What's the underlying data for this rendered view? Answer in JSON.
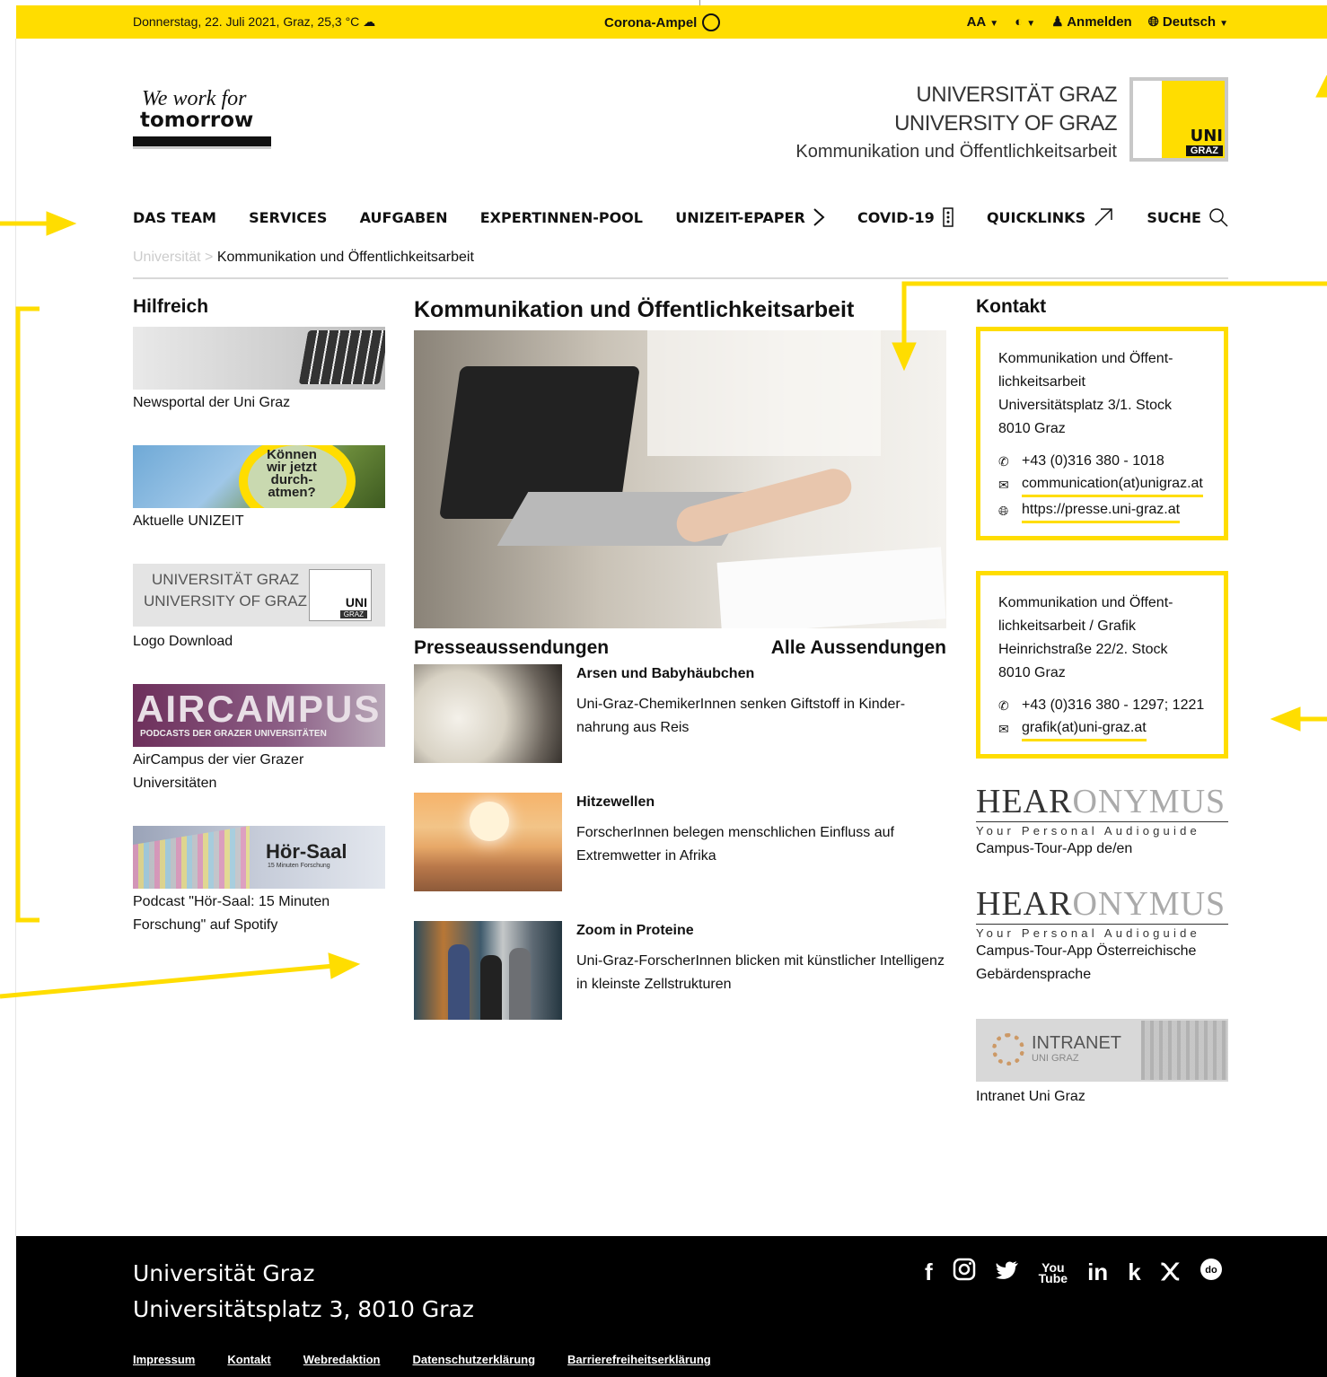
{
  "topbar": {
    "date_weather": "Donnerstag, 22. Juli 2021, Graz, 25,3 °C",
    "weather_icon": "cloud-icon",
    "corona": "Corona-Ampel",
    "font_size": "AA",
    "login": "Anmelden",
    "language": "Deutsch"
  },
  "header": {
    "tagline_1": "We work for",
    "tagline_2": "tomorrow",
    "name_de": "UNIVERSITÄT GRAZ",
    "name_en": "UNIVERSITY OF GRAZ",
    "department": "Kommunikation und Öffentlichkeitsarbeit",
    "logo_uni": "UNI",
    "logo_graz": "GRAZ"
  },
  "nav": {
    "items": [
      "DAS TEAM",
      "SERVICES",
      "AUFGABEN",
      "EXPERTINNEN-POOL",
      "UNIZEIT-EPAPER",
      "COVID-19",
      "QUICKLINKS",
      "SUCHE"
    ]
  },
  "breadcrumb": {
    "root": "Universität",
    "sep": ">",
    "current": "Kommunikation und Öffentlichkeitsarbeit"
  },
  "left": {
    "title": "Hilfreich",
    "tiles": [
      {
        "caption": "Newsportal der Uni Graz"
      },
      {
        "caption": "Aktuelle UNIZEIT",
        "image_text": "Können wir jetzt durch-atmen?"
      },
      {
        "caption": "Logo Download",
        "image_text_1": "UNIVERSITÄT GRAZ",
        "image_text_2": "UNIVERSITY OF GRAZ",
        "logo_uni": "UNI",
        "logo_graz": "GRAZ"
      },
      {
        "caption": "AirCampus der vier Grazer Universitäten",
        "image_text": "AIRCAMPUS",
        "image_sub": "PODCASTS DER GRAZER UNIVERSITÄTEN"
      },
      {
        "caption": "Podcast \"Hör-Saal: 15 Minuten Forschung\" auf Spotify",
        "image_text": "Hör-Saal",
        "image_sub": "15 Minuten Forschung"
      }
    ]
  },
  "main": {
    "title": "Kommunikation und Öffentlichkeitsarbeit",
    "press_title": "Presseaussendungen",
    "all_link": "Alle Aussendungen",
    "news": [
      {
        "title": "Arsen und Babyhäubchen",
        "desc": "Uni-Graz-ChemikerInnen senken Giftstoff in Kinder­nahrung aus Reis"
      },
      {
        "title": "Hitzewellen",
        "desc": "ForscherInnen belegen menschlichen Einfluss auf Extremwetter in Afrika"
      },
      {
        "title": "Zoom in Proteine",
        "desc": "Uni-Graz-ForscherInnen blicken mit künstlicher In­telligenz in kleinste Zellstrukturen"
      }
    ]
  },
  "right": {
    "title": "Kontakt",
    "box1": {
      "addr_1": "Kommunikation und Öffent­lichkeitsarbeit",
      "addr_2": "Universitätsplatz 3/1. Stock",
      "addr_3": "8010 Graz",
      "phone": "+43 (0)316 380 - 1018",
      "email": "communication(at)uni­graz.at",
      "web": "https://presse.uni-graz.at"
    },
    "box2": {
      "addr_1": "Kommunikation und Öffent­lichkeitsarbeit / Grafik",
      "addr_2": "Heinrichstraße 22/2. Stock",
      "addr_3": "8010 Graz",
      "phone": "+43 (0)316 380 - 1297; 1221",
      "email": "grafik(at)uni-graz.at"
    },
    "hear_logo_a": "HEAR",
    "hear_logo_b": "ONYMUS",
    "hear_tag": "Your Personal Audioguide",
    "hear1_caption": "Campus-Tour-App de/en",
    "hear2_caption": "Campus-Tour-App Österreichische Gebärdensprache",
    "intranet_text": "INTRANET",
    "intranet_sub": "UNI GRAZ",
    "intranet_caption": "Intranet Uni Graz"
  },
  "footer": {
    "line1": "Universität Graz",
    "line2": "Universitätsplatz 3, 8010 Graz",
    "social": [
      "facebook-icon",
      "instagram-icon",
      "twitter-icon",
      "youtube-icon",
      "linkedin-icon",
      "kununu-icon",
      "xing-icon",
      "uni-icon"
    ],
    "links": [
      "Impressum",
      "Kontakt",
      "Webredaktion",
      "Datenschutzerklärung",
      "Barrierefreiheitserklärung"
    ]
  },
  "colors": {
    "accent": "#ffdd00",
    "footer_bg": "#000000"
  }
}
